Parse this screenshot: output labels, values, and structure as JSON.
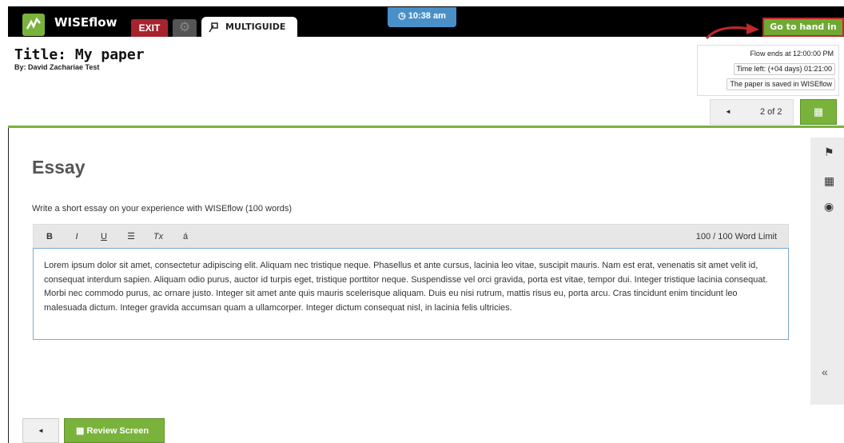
{
  "topbar": {
    "app_name": "WISEflow",
    "exit_label": "EXIT",
    "multiguide_label": "MULTIGUIDE",
    "clock_time": "10:38 am",
    "handin_label": "Go to hand in"
  },
  "header": {
    "title": "Title: My paper",
    "author": "By: David Zachariae Test"
  },
  "status": {
    "flow_ends": "Flow ends at 12:00:00 PM",
    "time_left": "Time left: (+04 days) 01:21:00",
    "saved": "The paper is saved in WISEflow"
  },
  "pager": {
    "prev_icon": "◄",
    "label": "2 of 2"
  },
  "main": {
    "section_title": "Essay",
    "prompt": "Write a short essay on your experience with WISEflow (100 words)",
    "toolbar": {
      "bold": "B",
      "italic": "I",
      "underline": "U",
      "list": "☰",
      "clear_format": "Tx",
      "special_char": "á",
      "word_limit": "100 / 100 Word Limit"
    },
    "essay_text": "Lorem ipsum dolor sit amet, consectetur adipiscing elit. Aliquam nec tristique neque. Phasellus et ante cursus, lacinia leo vitae, suscipit mauris. Nam est erat, venenatis sit amet velit id, consequat interdum sapien. Aliquam odio purus, auctor id turpis eget, tristique porttitor neque. Suspendisse vel orci gravida, porta est vitae, tempor dui. Integer tristique lacinia consequat. Morbi nec commodo purus, ac ornare justo. Integer sit amet ante quis mauris scelerisque aliquam. Duis eu nisi rutrum, mattis risus eu, porta arcu. Cras tincidunt enim tincidunt leo malesuada dictum. Integer gravida accumsan quam a ullamcorper. Integer dictum consequat nisl, in lacinia felis ultricies."
  },
  "bottom": {
    "prev_icon": "◄",
    "review_label": "Review Screen"
  },
  "colors": {
    "brand_green": "#7ab33c",
    "exit_red": "#a6232e",
    "clock_blue": "#4a90c8",
    "highlight_red": "#c1272d"
  }
}
